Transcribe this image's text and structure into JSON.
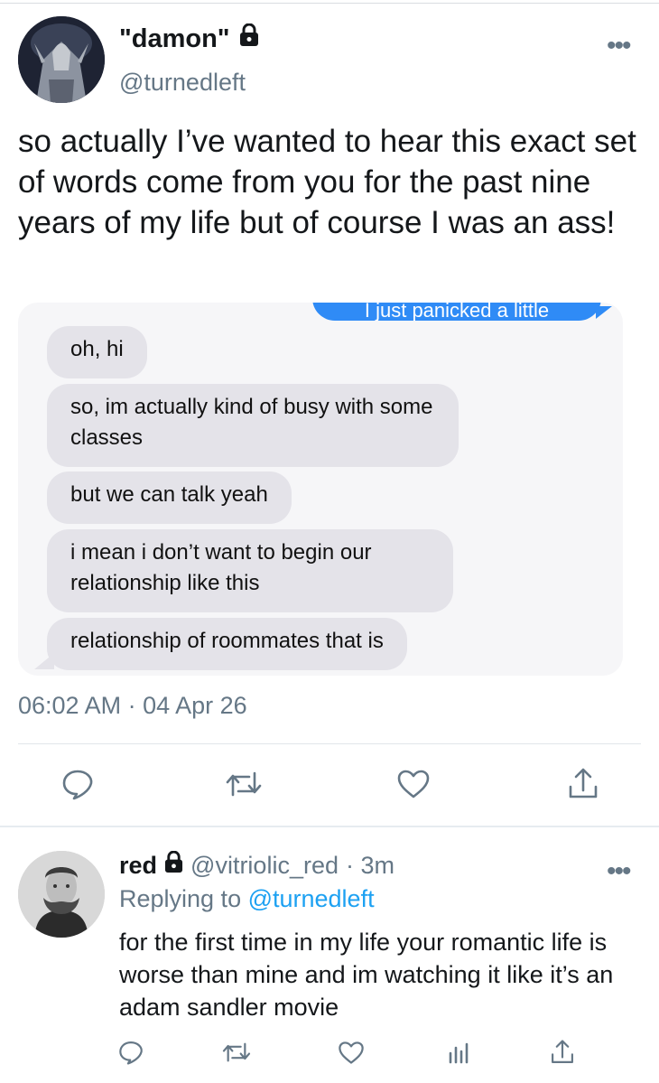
{
  "tweet": {
    "display_name": "\"damon\"",
    "handle": "@turnedleft",
    "more_label": "•••",
    "text": "so actually I’ve wanted to hear this exact set of words come from you for the past nine years of my life but of course I was an ass!",
    "timestamp": "06:02 AM · 04 Apr 26",
    "icons": [
      "reply-icon",
      "retweet-icon",
      "like-icon",
      "share-icon"
    ]
  },
  "image": {
    "sent_partial": "I just panicked a little",
    "messages": [
      "oh, hi",
      "so, im actually kind of busy with some classes",
      "but we can talk yeah",
      "i mean i don’t want to begin our relationship like this",
      "relationship of roommates that is"
    ],
    "colors": {
      "sent": "#2f8bf6",
      "received": "#e4e3e9"
    }
  },
  "reply": {
    "display_name": "red",
    "handle": "@vitriolic_red",
    "time": "· 3m",
    "more_label": "•••",
    "replying_prefix": "Replying to ",
    "replying_to": "@turnedleft",
    "text": "for the first time in my life your romantic life is worse than mine and im watching it like it’s an adam sandler movie",
    "icons": [
      "reply-icon",
      "retweet-icon",
      "like-icon",
      "analytics-icon",
      "share-icon"
    ]
  },
  "colors": {
    "link": "#1da1f2",
    "secondary": "#657786",
    "primary_text": "#14171a"
  }
}
